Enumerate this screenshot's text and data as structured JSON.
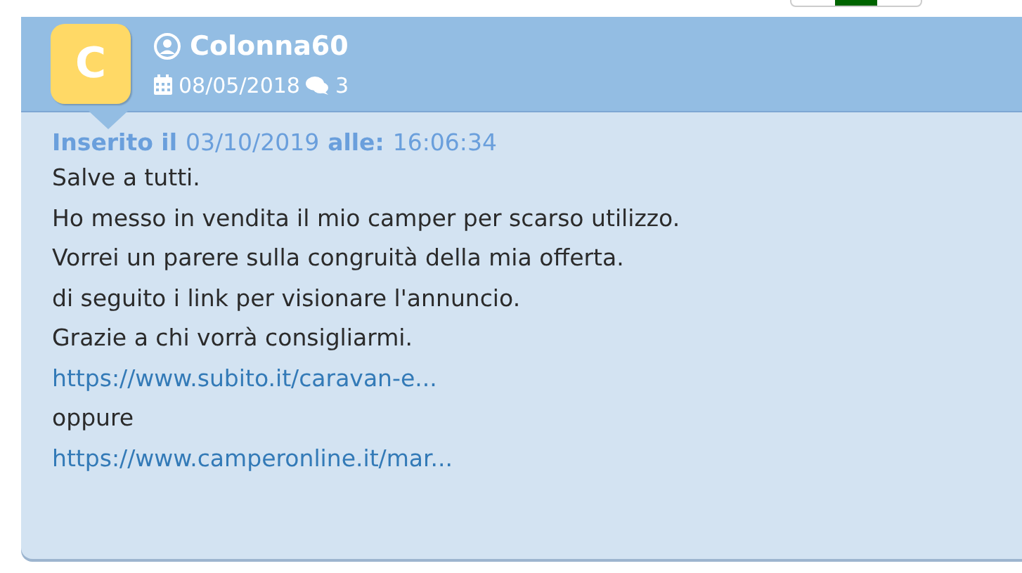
{
  "author": {
    "initial": "C",
    "name": "Colonna60",
    "joined": "08/05/2018",
    "posts": "3"
  },
  "post": {
    "posted_label": "Inserito il",
    "date": "03/10/2019",
    "time_label": "alle:",
    "time": "16:06:34",
    "lines": [
      {
        "kind": "text",
        "text": "Salve a tutti."
      },
      {
        "kind": "text",
        "text": "Ho messo in vendita il mio camper per scarso utilizzo."
      },
      {
        "kind": "text",
        "text": "Vorrei un parere sulla congruità della mia offerta."
      },
      {
        "kind": "text",
        "text": "di seguito i link per visionare l'annuncio."
      },
      {
        "kind": "text",
        "text": "Grazie a chi vorrà consigliarmi."
      },
      {
        "kind": "link",
        "text": "https://www.subito.it/caravan-e..."
      },
      {
        "kind": "text",
        "text": "oppure"
      },
      {
        "kind": "link",
        "text": "https://www.camperonline.it/mar..."
      }
    ]
  }
}
